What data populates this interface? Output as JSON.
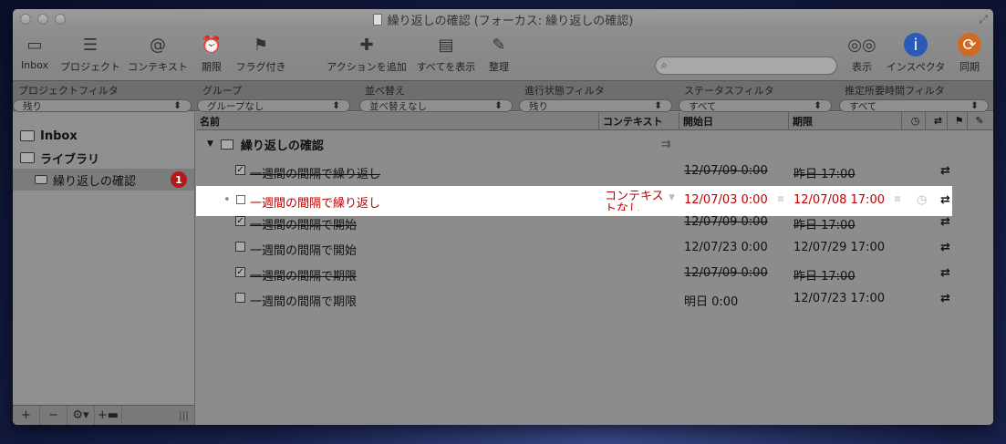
{
  "window": {
    "title": "繰り返しの確認 (フォーカス: 繰り返しの確認)"
  },
  "toolbar": {
    "inbox": "Inbox",
    "project": "プロジェクト",
    "context": "コンテキスト",
    "due": "期限",
    "flagged": "フラグ付き",
    "add_action": "アクションを追加",
    "show_all": "すべてを表示",
    "clean_up": "整理",
    "search_label": "検索",
    "search_placeholder": "",
    "view": "表示",
    "inspector": "インスペクタ",
    "sync": "同期"
  },
  "filters": [
    {
      "label": "プロジェクトフィルタ",
      "value": "残り",
      "icon": "project-filter-icon"
    },
    {
      "label": "グループ",
      "value": "グループなし",
      "icon": "group-icon"
    },
    {
      "label": "並べ替え",
      "value": "並べ替えなし",
      "icon": "sort-icon"
    },
    {
      "label": "進行状態フィルタ",
      "value": "残り",
      "icon": "checkbox-icon"
    },
    {
      "label": "ステータスフィルタ",
      "value": "すべて",
      "icon": "flag-icon"
    },
    {
      "label": "推定所要時間フィルタ",
      "value": "すべて",
      "icon": "clock-icon"
    }
  ],
  "sidebar": {
    "inbox": "Inbox",
    "library": "ライブラリ",
    "project": "繰り返しの確認",
    "badge": "1",
    "add": "+",
    "remove": "−",
    "gear": "⚙▾",
    "add_folder": "+▬"
  },
  "columns": {
    "name": "名前",
    "context": "コンテキスト",
    "start": "開始日",
    "due": "期限"
  },
  "group": {
    "title": "繰り返しの確認"
  },
  "rows": [
    {
      "name": "一週間の間隔で繰り返し",
      "start": "12/07/09 0:00",
      "due": "昨日 17:00",
      "done": true
    },
    {
      "name": "一週間の間隔で開始",
      "start": "12/07/09 0:00",
      "due": "昨日 17:00",
      "done": true
    },
    {
      "name": "一週間の間隔で開始",
      "start": "12/07/23 0:00",
      "due": "12/07/29 17:00",
      "done": false
    },
    {
      "name": "一週間の間隔で期限",
      "start": "12/07/09 0:00",
      "due": "昨日 17:00",
      "done": true
    },
    {
      "name": "一週間の間隔で期限",
      "start": "明日 0:00",
      "due": "12/07/23 17:00",
      "done": false
    }
  ],
  "selected_row": {
    "name": "一週間の間隔で繰り返し",
    "context": "コンテキストなし",
    "start": "12/07/03 0:00",
    "due": "12/07/08 17:00"
  },
  "colors": {
    "overdue_red": "#c00000",
    "badge_red": "#b01a1a"
  }
}
